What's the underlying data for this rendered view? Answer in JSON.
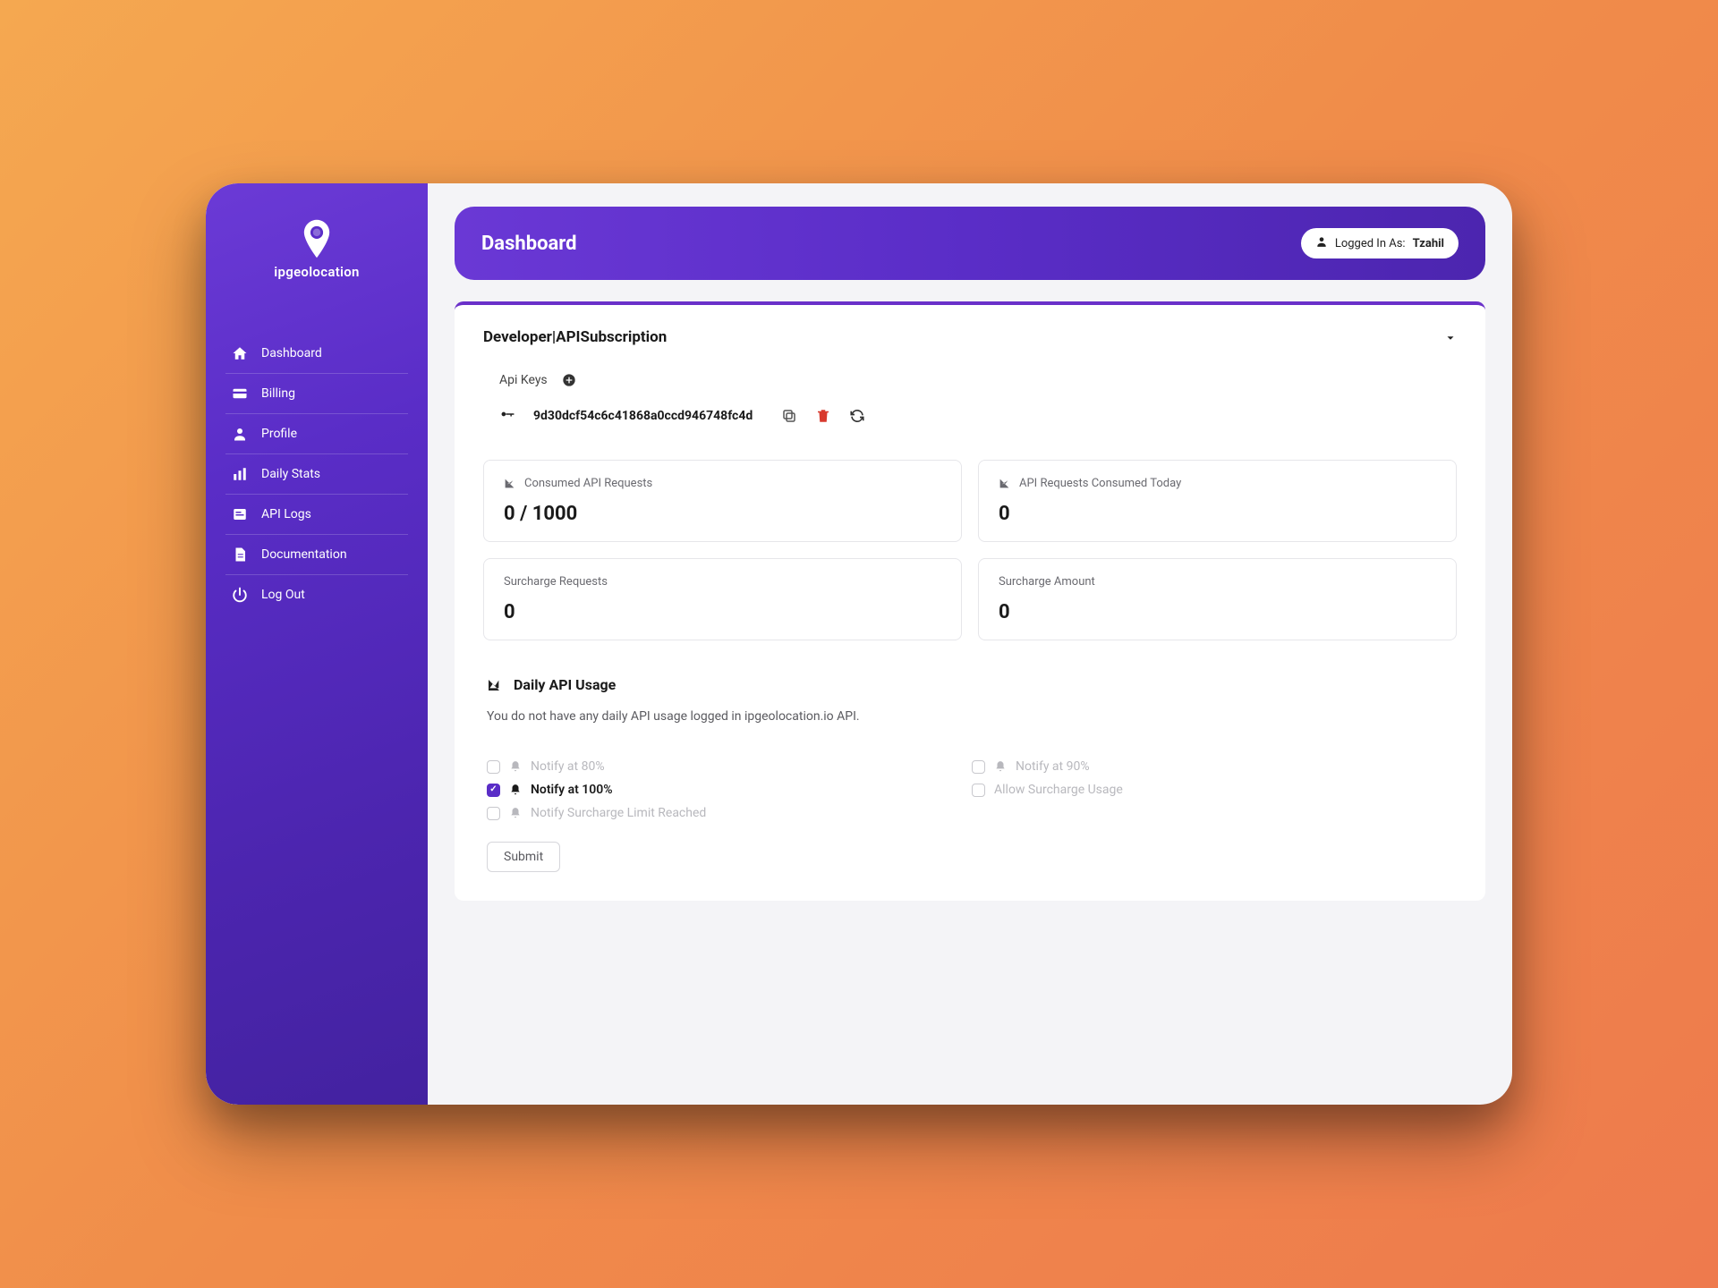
{
  "brand": "ipgeolocation",
  "sidebar": {
    "items": [
      {
        "label": "Dashboard"
      },
      {
        "label": "Billing"
      },
      {
        "label": "Profile"
      },
      {
        "label": "Daily Stats"
      },
      {
        "label": "API Logs"
      },
      {
        "label": "Documentation"
      },
      {
        "label": "Log Out"
      }
    ]
  },
  "header": {
    "title": "Dashboard",
    "logged_in_prefix": "Logged In As: ",
    "user_name": "Tzahil"
  },
  "card": {
    "title": "Developer|APISubscription",
    "api_keys_label": "Api Keys",
    "key_value": "9d30dcf54c6c41868a0ccd946748fc4d",
    "stats": [
      {
        "label": "Consumed API Requests",
        "value": "0 / 1000",
        "show_icon": true
      },
      {
        "label": "API Requests Consumed Today",
        "value": "0",
        "show_icon": true
      },
      {
        "label": "Surcharge Requests",
        "value": "0",
        "show_icon": false
      },
      {
        "label": "Surcharge Amount",
        "value": "0",
        "show_icon": false
      }
    ],
    "usage_title": "Daily API Usage",
    "usage_message": "You do not have any daily API usage logged in ipgeolocation.io API.",
    "notifications": {
      "notify_80": "Notify at 80%",
      "notify_90": "Notify at 90%",
      "notify_100": "Notify at 100%",
      "allow_surcharge": "Allow Surcharge Usage",
      "notify_surcharge_limit": "Notify Surcharge Limit Reached"
    },
    "submit_label": "Submit"
  }
}
